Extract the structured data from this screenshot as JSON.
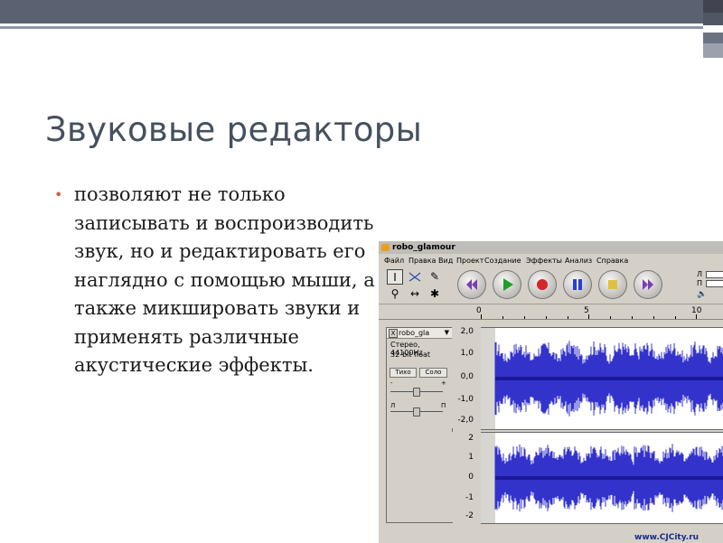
{
  "slide": {
    "title": "Звуковые редакторы",
    "bullet": "позволяют не только записывать и воспроизводить звук, но и редактировать его наглядно с помощью мыши, а также микшировать звуки и применять различные акустические эффекты."
  },
  "app": {
    "title": "robo_glamour",
    "menu": [
      "Файл",
      "Правка",
      "Вид",
      "Проект",
      "Создание",
      "Эффекты",
      "Анализ",
      "Справка"
    ],
    "transport": [
      {
        "name": "skip-to-start",
        "icon": "skip-back-icon"
      },
      {
        "name": "play",
        "icon": "play-icon"
      },
      {
        "name": "record",
        "icon": "record-icon"
      },
      {
        "name": "pause",
        "icon": "pause-icon"
      },
      {
        "name": "stop",
        "icon": "stop-icon"
      },
      {
        "name": "skip-to-end",
        "icon": "skip-forward-icon"
      }
    ],
    "meter_labels": {
      "left": "Л",
      "right": "П"
    },
    "ruler": [
      "0",
      "5",
      "10"
    ],
    "track": {
      "name": "robo_gla",
      "close": "X",
      "menu_arrow": "▼",
      "info_line1": "Стерео, 44100Hz",
      "info_line2": "32-bit float",
      "mute": "Тихо",
      "solo": "Соло",
      "gain_minus": "-",
      "gain_plus": "+",
      "pan_left": "Л",
      "pan_right": "П"
    },
    "scale_top": [
      "2,0",
      "1,0",
      "0,0",
      "-1,0",
      "-2,0"
    ],
    "scale_bottom": [
      "2",
      "1",
      "0",
      "-1",
      "-2"
    ],
    "colors": {
      "waveform": "#3333cc",
      "waveform_dark": "#1a1a99",
      "selection": "#d8d6d0"
    }
  },
  "watermark": "www.CJCity.ru"
}
